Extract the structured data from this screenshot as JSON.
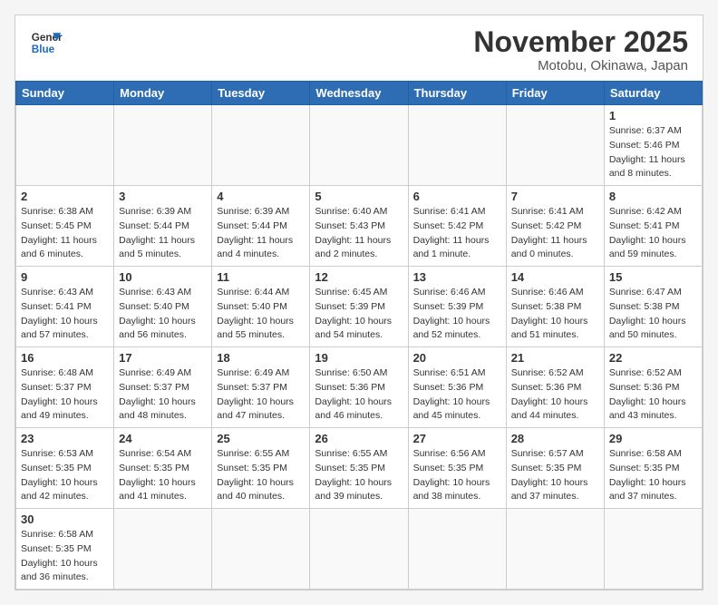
{
  "header": {
    "logo_line1": "General",
    "logo_line2": "Blue",
    "month_title": "November 2025",
    "location": "Motobu, Okinawa, Japan"
  },
  "weekdays": [
    "Sunday",
    "Monday",
    "Tuesday",
    "Wednesday",
    "Thursday",
    "Friday",
    "Saturday"
  ],
  "weeks": [
    [
      {
        "day": "",
        "info": ""
      },
      {
        "day": "",
        "info": ""
      },
      {
        "day": "",
        "info": ""
      },
      {
        "day": "",
        "info": ""
      },
      {
        "day": "",
        "info": ""
      },
      {
        "day": "",
        "info": ""
      },
      {
        "day": "1",
        "info": "Sunrise: 6:37 AM\nSunset: 5:46 PM\nDaylight: 11 hours\nand 8 minutes."
      }
    ],
    [
      {
        "day": "2",
        "info": "Sunrise: 6:38 AM\nSunset: 5:45 PM\nDaylight: 11 hours\nand 6 minutes."
      },
      {
        "day": "3",
        "info": "Sunrise: 6:39 AM\nSunset: 5:44 PM\nDaylight: 11 hours\nand 5 minutes."
      },
      {
        "day": "4",
        "info": "Sunrise: 6:39 AM\nSunset: 5:44 PM\nDaylight: 11 hours\nand 4 minutes."
      },
      {
        "day": "5",
        "info": "Sunrise: 6:40 AM\nSunset: 5:43 PM\nDaylight: 11 hours\nand 2 minutes."
      },
      {
        "day": "6",
        "info": "Sunrise: 6:41 AM\nSunset: 5:42 PM\nDaylight: 11 hours\nand 1 minute."
      },
      {
        "day": "7",
        "info": "Sunrise: 6:41 AM\nSunset: 5:42 PM\nDaylight: 11 hours\nand 0 minutes."
      },
      {
        "day": "8",
        "info": "Sunrise: 6:42 AM\nSunset: 5:41 PM\nDaylight: 10 hours\nand 59 minutes."
      }
    ],
    [
      {
        "day": "9",
        "info": "Sunrise: 6:43 AM\nSunset: 5:41 PM\nDaylight: 10 hours\nand 57 minutes."
      },
      {
        "day": "10",
        "info": "Sunrise: 6:43 AM\nSunset: 5:40 PM\nDaylight: 10 hours\nand 56 minutes."
      },
      {
        "day": "11",
        "info": "Sunrise: 6:44 AM\nSunset: 5:40 PM\nDaylight: 10 hours\nand 55 minutes."
      },
      {
        "day": "12",
        "info": "Sunrise: 6:45 AM\nSunset: 5:39 PM\nDaylight: 10 hours\nand 54 minutes."
      },
      {
        "day": "13",
        "info": "Sunrise: 6:46 AM\nSunset: 5:39 PM\nDaylight: 10 hours\nand 52 minutes."
      },
      {
        "day": "14",
        "info": "Sunrise: 6:46 AM\nSunset: 5:38 PM\nDaylight: 10 hours\nand 51 minutes."
      },
      {
        "day": "15",
        "info": "Sunrise: 6:47 AM\nSunset: 5:38 PM\nDaylight: 10 hours\nand 50 minutes."
      }
    ],
    [
      {
        "day": "16",
        "info": "Sunrise: 6:48 AM\nSunset: 5:37 PM\nDaylight: 10 hours\nand 49 minutes."
      },
      {
        "day": "17",
        "info": "Sunrise: 6:49 AM\nSunset: 5:37 PM\nDaylight: 10 hours\nand 48 minutes."
      },
      {
        "day": "18",
        "info": "Sunrise: 6:49 AM\nSunset: 5:37 PM\nDaylight: 10 hours\nand 47 minutes."
      },
      {
        "day": "19",
        "info": "Sunrise: 6:50 AM\nSunset: 5:36 PM\nDaylight: 10 hours\nand 46 minutes."
      },
      {
        "day": "20",
        "info": "Sunrise: 6:51 AM\nSunset: 5:36 PM\nDaylight: 10 hours\nand 45 minutes."
      },
      {
        "day": "21",
        "info": "Sunrise: 6:52 AM\nSunset: 5:36 PM\nDaylight: 10 hours\nand 44 minutes."
      },
      {
        "day": "22",
        "info": "Sunrise: 6:52 AM\nSunset: 5:36 PM\nDaylight: 10 hours\nand 43 minutes."
      }
    ],
    [
      {
        "day": "23",
        "info": "Sunrise: 6:53 AM\nSunset: 5:35 PM\nDaylight: 10 hours\nand 42 minutes."
      },
      {
        "day": "24",
        "info": "Sunrise: 6:54 AM\nSunset: 5:35 PM\nDaylight: 10 hours\nand 41 minutes."
      },
      {
        "day": "25",
        "info": "Sunrise: 6:55 AM\nSunset: 5:35 PM\nDaylight: 10 hours\nand 40 minutes."
      },
      {
        "day": "26",
        "info": "Sunrise: 6:55 AM\nSunset: 5:35 PM\nDaylight: 10 hours\nand 39 minutes."
      },
      {
        "day": "27",
        "info": "Sunrise: 6:56 AM\nSunset: 5:35 PM\nDaylight: 10 hours\nand 38 minutes."
      },
      {
        "day": "28",
        "info": "Sunrise: 6:57 AM\nSunset: 5:35 PM\nDaylight: 10 hours\nand 37 minutes."
      },
      {
        "day": "29",
        "info": "Sunrise: 6:58 AM\nSunset: 5:35 PM\nDaylight: 10 hours\nand 37 minutes."
      }
    ],
    [
      {
        "day": "30",
        "info": "Sunrise: 6:58 AM\nSunset: 5:35 PM\nDaylight: 10 hours\nand 36 minutes."
      },
      {
        "day": "",
        "info": ""
      },
      {
        "day": "",
        "info": ""
      },
      {
        "day": "",
        "info": ""
      },
      {
        "day": "",
        "info": ""
      },
      {
        "day": "",
        "info": ""
      },
      {
        "day": "",
        "info": ""
      }
    ]
  ]
}
